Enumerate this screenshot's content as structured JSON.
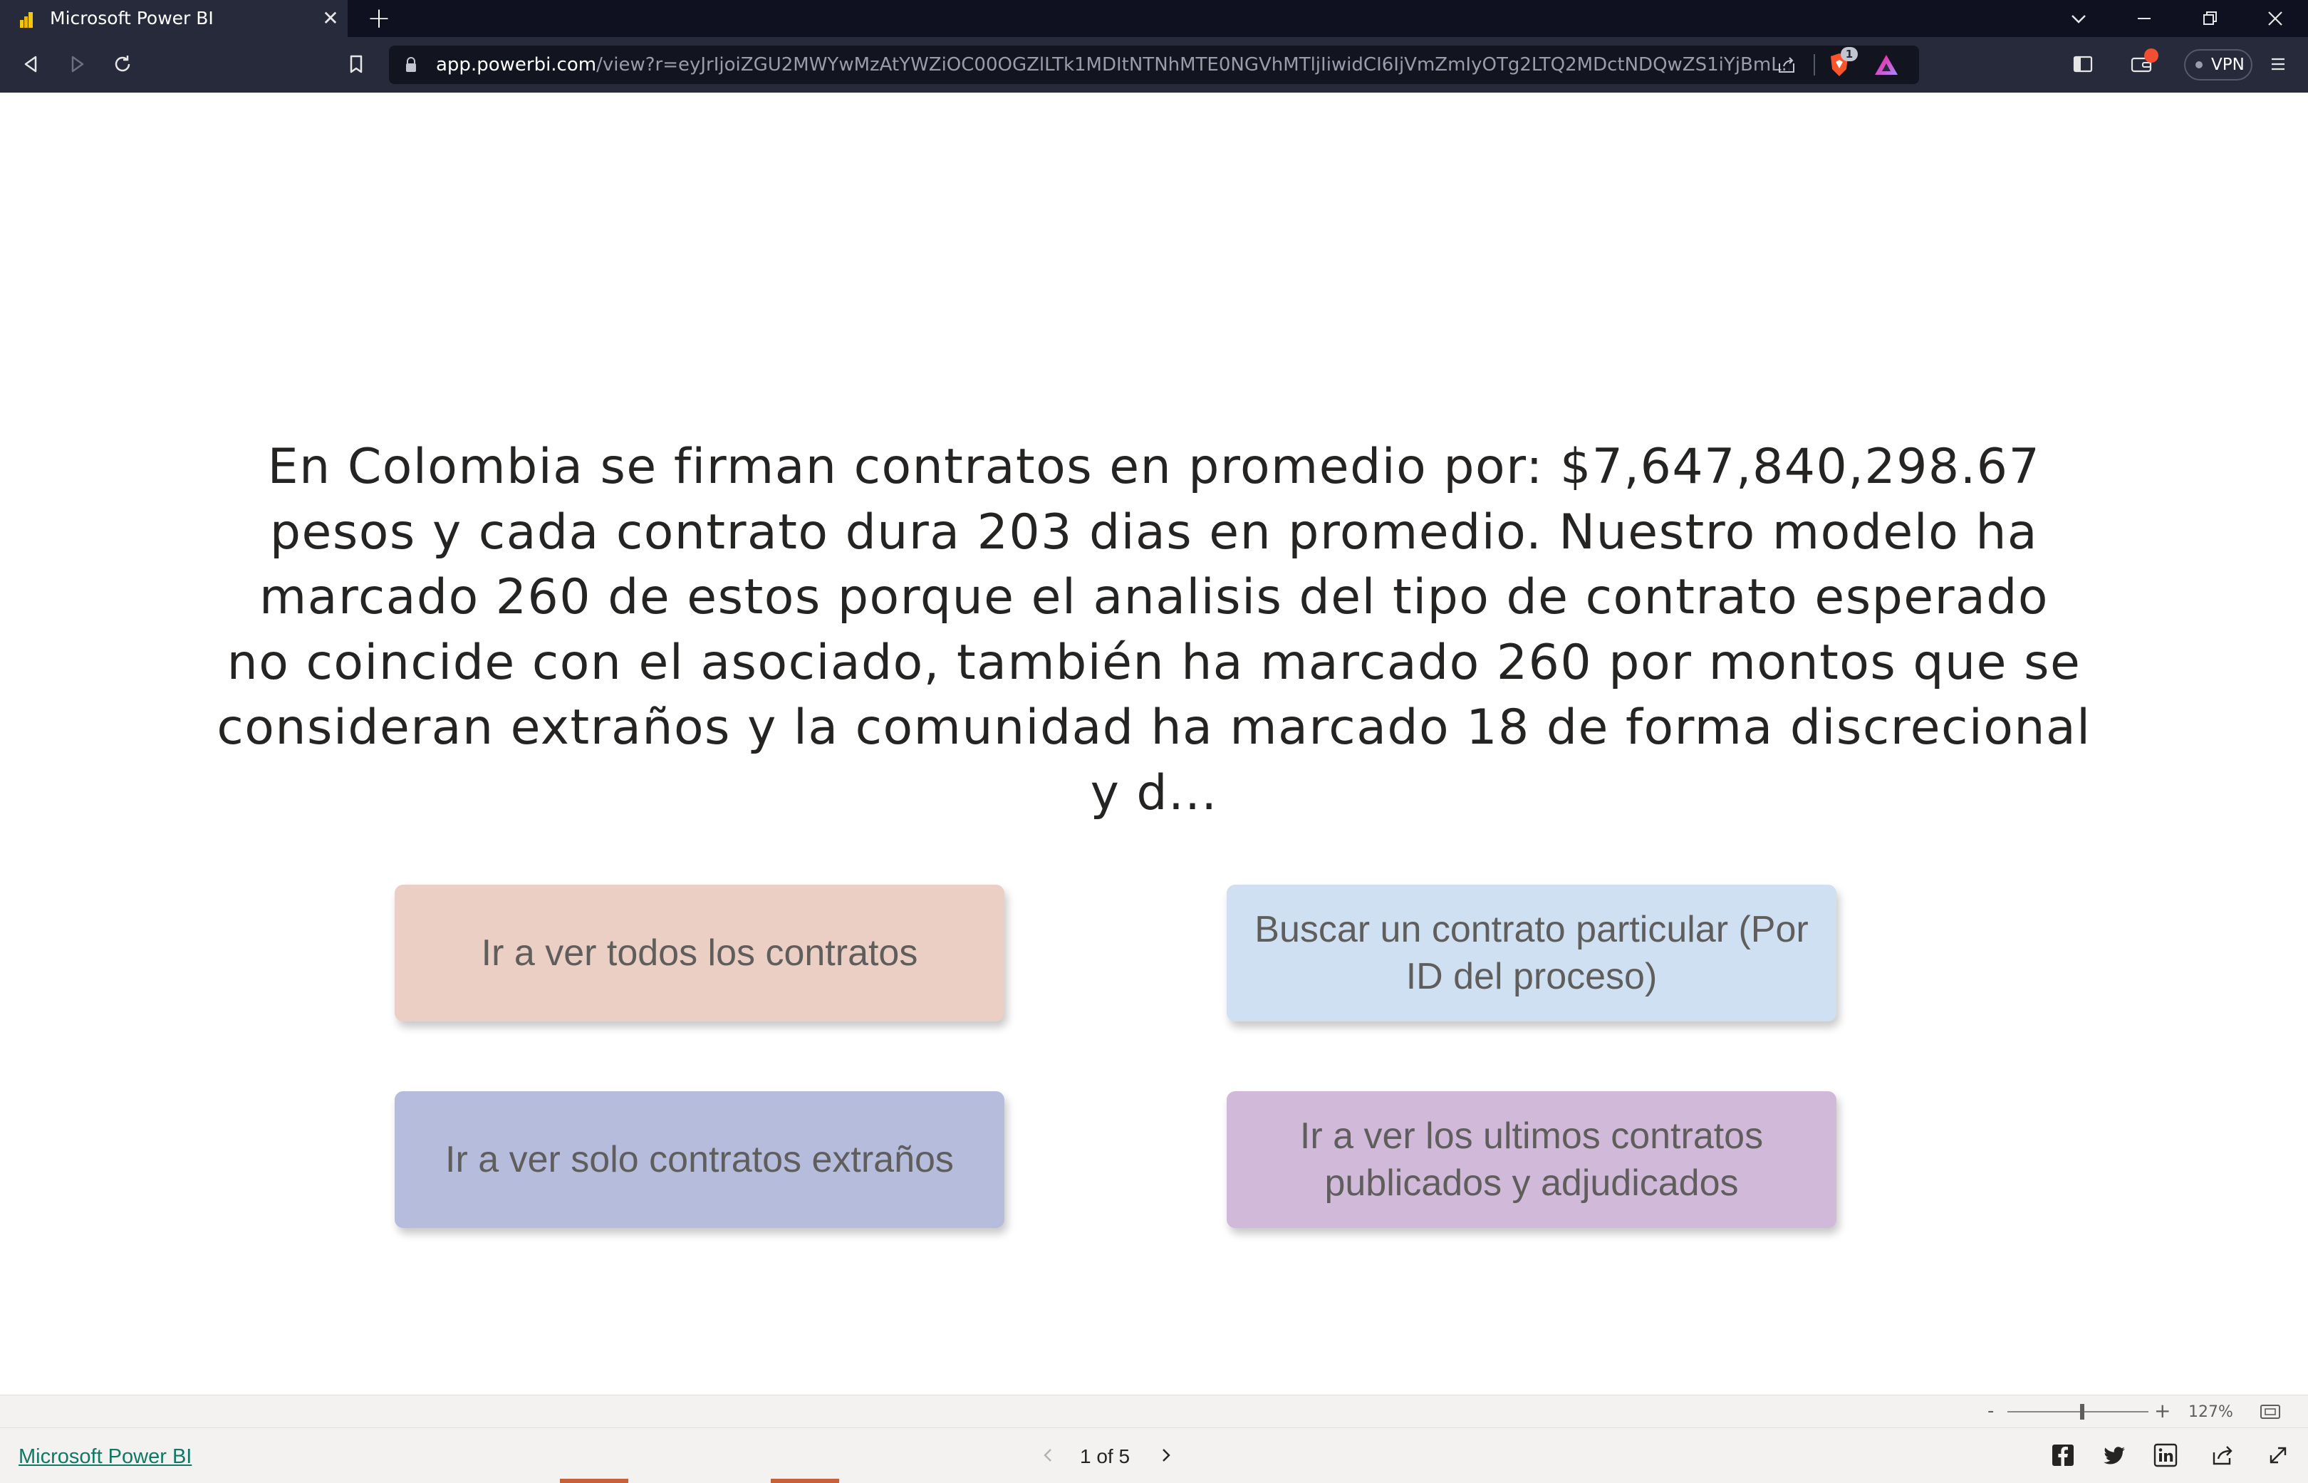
{
  "browser": {
    "tab_title": "Microsoft Power BI",
    "tab_close_glyph": "✕",
    "new_tab_glyph": "+",
    "url_host": "app.powerbi.com",
    "url_path": "/view?r=eyJrIjoiZGU2MWYwMzAtYWZiOC00OGZlLTk1MDItNTNhMTE0NGVhMTljIiwidCI6IjVmZmIyOTg2LTQ2MDctNDQwZS1iYjBmL...",
    "shield_count": "1",
    "vpn_label": "VPN",
    "icons": [
      "back-icon",
      "forward-icon",
      "reload-icon",
      "bookmark-icon",
      "lock-icon",
      "share-icon",
      "brave-shield-icon",
      "brave-rewards-icon",
      "sidebar-icon",
      "wallet-icon",
      "menu-icon"
    ],
    "colors": {
      "chrome": "#272a3b",
      "tabbar": "#0f1120",
      "url_bg": "#12141f"
    }
  },
  "report": {
    "summary": "En Colombia se firman contratos en promedio por: $7,647,840,298.67 pesos y cada contrato dura 203 dias en promedio. Nuestro modelo ha marcado 260 de estos porque el analisis del tipo de contrato esperado no coincide con el asociado, también ha marcado 260 por montos que se consideran extraños y la comunidad ha marcado 18 de forma discrecional y d...",
    "summary_lines": [
      "En Colombia se firman contratos en promedio por: $7,647,840,298.67",
      "pesos y cada contrato dura 203 dias en promedio. Nuestro modelo ha",
      "marcado 260 de estos porque el analisis del tipo de contrato esperado",
      "no coincide con el asociado, también ha marcado 260 por montos que se",
      "consideran extraños y la comunidad ha marcado 18 de forma discrecional y d..."
    ],
    "buttons": {
      "all_contracts": "Ir a ver todos los contratos",
      "search_contract": "Buscar un contrato particular (Por ID del proceso)",
      "strange_contracts": "Ir a ver solo contratos extraños",
      "latest_contracts": "Ir a ver los ultimos contratos publicados y adjudicados"
    },
    "button_colors": {
      "all_contracts": "#ebcfc4",
      "search_contract": "#cfe0f2",
      "strange_contracts": "#b6bcdc",
      "latest_contracts": "#d1b9d9"
    }
  },
  "zoom": {
    "minus": "-",
    "plus": "+",
    "level": "127%",
    "level_value": 127
  },
  "footer": {
    "brand": "Microsoft Power BI",
    "page_indicator": "1 of 5",
    "share_icons": [
      "facebook-icon",
      "twitter-icon",
      "linkedin-icon",
      "share-icon",
      "fullscreen-icon"
    ]
  }
}
